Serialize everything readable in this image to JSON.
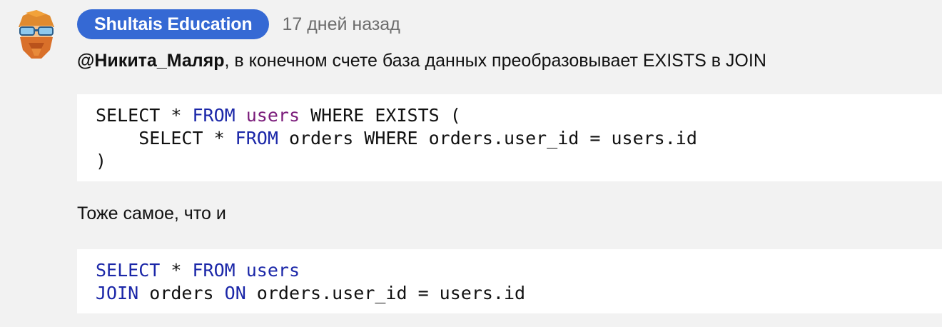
{
  "comment": {
    "author": "Shultais Education",
    "timestamp": "17 дней назад",
    "avatar_icon": "bearded-man-sunglasses-avatar",
    "paragraph1": {
      "mention": "@Никита_Маляр",
      "text": ", в конечном счете база данных преобразовывает EXISTS в JOIN"
    },
    "code1": {
      "line1": {
        "a": "SELECT * ",
        "b": "FROM",
        "c": " ",
        "d": "users",
        "e": " WHERE EXISTS ("
      },
      "line2": {
        "a": "    SELECT * ",
        "b": "FROM",
        "c": " orders WHERE orders.user_id = users.id"
      },
      "line3": {
        "a": ")"
      }
    },
    "paragraph2": "Тоже самое, что и",
    "code2": {
      "line1": {
        "a": "SELECT",
        "b": " * ",
        "c": "FROM",
        "d": " ",
        "e": "users"
      },
      "line2": {
        "a": "JOIN",
        "b": " orders ",
        "c": "ON",
        "d": " orders.user_id = users.id"
      }
    }
  },
  "colors": {
    "badge": "#3569d4",
    "keyword": "#1b27a8",
    "identifier": "#7a1b7a",
    "background": "#f2f2f2"
  }
}
